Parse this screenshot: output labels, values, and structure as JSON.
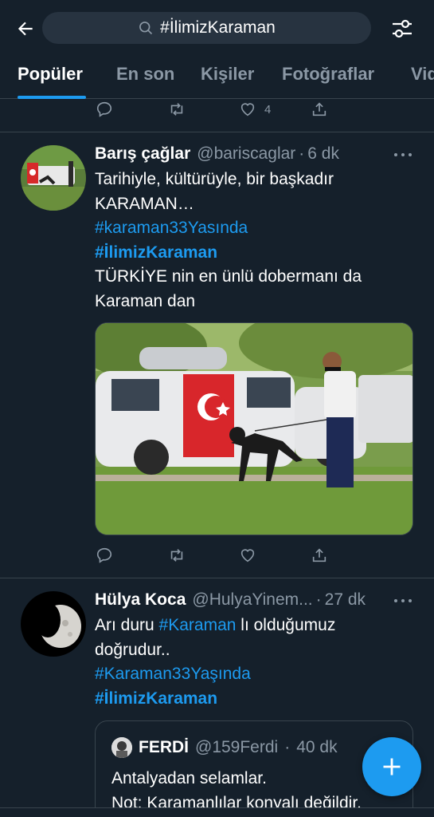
{
  "search": {
    "query": "#İlimizKaraman"
  },
  "tabs": [
    {
      "label": "Popüler"
    },
    {
      "label": "En son"
    },
    {
      "label": "Kişiler"
    },
    {
      "label": "Fotoğraflar"
    },
    {
      "label": "Vid"
    }
  ],
  "prev_tweet": {
    "like_count": "4"
  },
  "tweets": [
    {
      "name": "Barış çağlar",
      "handle": "@bariscaglar",
      "time": "6 dk",
      "lines": [
        "Tarihiyle, kültürüyle, bir başkadır",
        "KARAMAN…"
      ],
      "hashtag1": "#karaman33Yasında",
      "hashtag2": "#İlimizKaraman",
      "lines2": [
        "TÜRKİYE nin en ünlü dobermanı da",
        "Karaman dan"
      ]
    },
    {
      "name": "Hülya Koca",
      "handle": "@HulyaYinem...",
      "time": "27 dk",
      "text_pre": "Arı duru ",
      "inline_tag": "#Karaman",
      "text_post": " lı olduğumuz",
      "line2": "doğrudur..",
      "hashtag1": "#Karaman33Yaşında",
      "hashtag2": "#İlimizKaraman",
      "quote": {
        "name": "FERDİ",
        "handle": "@159Ferdi",
        "time": "40 dk",
        "line1": "Antalyadan selamlar.",
        "line2": "Not: Karamanlılar konyalı değildir."
      }
    }
  ],
  "colors": {
    "accent": "#1d9bf0",
    "background": "#15202b",
    "muted": "#8b98a5",
    "border": "#38444d"
  }
}
